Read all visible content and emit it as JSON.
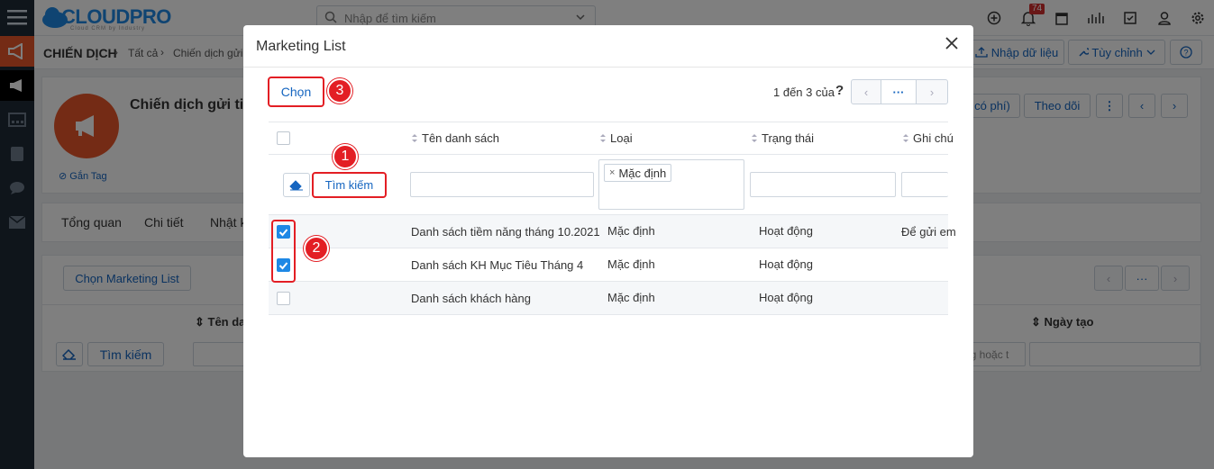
{
  "app": {
    "logo_text": "CLOUDPRO",
    "logo_tagline": "Cloud CRM by Industry"
  },
  "topbar": {
    "search_placeholder": "Nhập để tìm kiếm",
    "notifications_count": "74"
  },
  "breadcrumb": {
    "module": "CHIẾN DỊCH",
    "items": [
      "Tất cả",
      "Chiến dịch gửi"
    ]
  },
  "header_actions": {
    "import_label": "Nhập dữ liệu",
    "customize_label": "Tùy chỉnh"
  },
  "record": {
    "title": "Chiến dịch gửi tin",
    "tag_label": "Gắn Tag",
    "btn_paid": "có phí)",
    "btn_follow": "Theo dõi"
  },
  "tabs": [
    "Tổng quan",
    "Chi tiết",
    "Nhật k"
  ],
  "related": {
    "choose_button": "Chọn Marketing List",
    "col_name": "Tên dan",
    "col_created": "Ngày tạo",
    "search_button": "Tìm kiếm",
    "date_placeholder": "ng hoặc t"
  },
  "modal": {
    "title": "Marketing List",
    "choose_button": "Chọn",
    "pagination_text": "1 đến 3 của",
    "pagination_help": "?",
    "more_label": "···",
    "columns": [
      "Tên danh sách",
      "Loại",
      "Trạng thái",
      "Ghi chú"
    ],
    "search_button": "Tìm kiếm",
    "type_filter_tag": "Mặc định",
    "rows": [
      {
        "name": "Danh sách tiềm năng tháng 10.2021",
        "type": "Mặc định",
        "status": "Hoạt động",
        "note": "Để gửi em",
        "checked": true
      },
      {
        "name": "Danh sách KH Mục Tiêu Tháng 4",
        "type": "Mặc định",
        "status": "Hoạt động",
        "note": "",
        "checked": true
      },
      {
        "name": "Danh sách khách hàng",
        "type": "Mặc định",
        "status": "Hoạt động",
        "note": "",
        "checked": false
      }
    ]
  },
  "annotations": {
    "step1": "1",
    "step2": "2",
    "step3": "3",
    "color": "#e31e24"
  },
  "colors": {
    "accent": "#1565c0",
    "rail": "#1e2a36",
    "avatar": "#e8572a"
  }
}
